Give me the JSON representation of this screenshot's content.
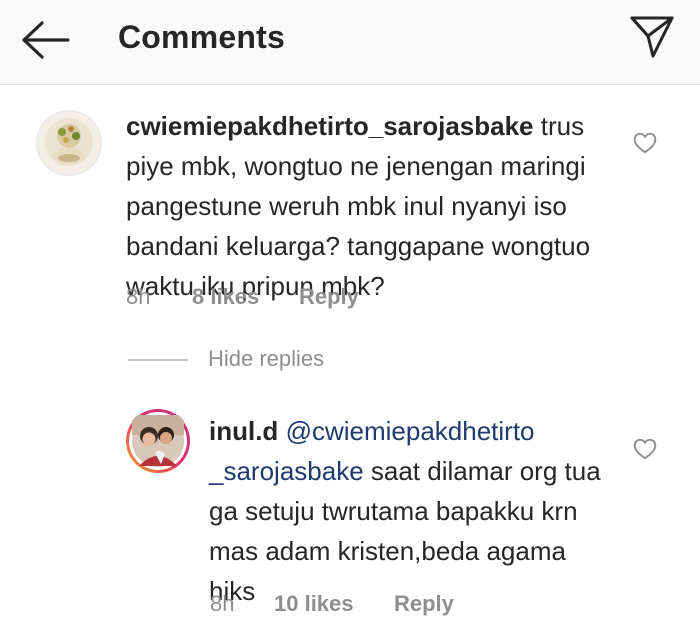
{
  "header": {
    "title": "Comments",
    "back_icon": "arrow-left-icon",
    "share_icon": "paper-plane-icon"
  },
  "comments": [
    {
      "username": "cwiemiepakdhetirto_sarojasbake",
      "text": " trus piye mbk, wongtuo ne jenengan maringi pangestune weruh mbk inul nyanyi iso bandani keluarga? tanggapane wongtuo waktu iku pripun mbk?",
      "time": "8h",
      "likes": "8 likes",
      "reply_label": "Reply"
    }
  ],
  "thread": {
    "hide_replies_label": "Hide replies"
  },
  "replies": [
    {
      "username": "inul.d",
      "mention": "@cwiemiepakdhetirto_sarojasbake",
      "mention_line1": "@cwiemiepakdhetirto",
      "mention_line2": "_sarojasbake",
      "text": " saat dilamar org tua ga setuju twrutama bapakku krn mas adam kristen,beda agama hiks",
      "time": "8h",
      "likes": "10 likes",
      "reply_label": "Reply"
    }
  ],
  "colors": {
    "text": "#262626",
    "secondary": "#8e8e8e",
    "mention": "#1e3a6e",
    "header_bg": "#fafafa"
  }
}
